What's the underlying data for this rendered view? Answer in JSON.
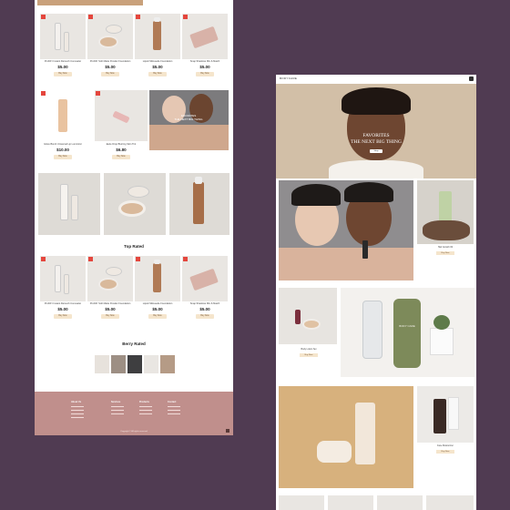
{
  "left_page": {
    "featured_products": [
      {
        "name": "ProFilt'r Instant Retouch Concealer",
        "price": "$5.00",
        "button": "Buy Now"
      },
      {
        "name": "ProFilt'r Soft Matte Powder Foundation",
        "price": "$5.00",
        "button": "Buy Now"
      },
      {
        "name": "Liquid Silksuede Foundation",
        "price": "$5.00",
        "button": "Buy Now"
      },
      {
        "name": "Snap Shadows Mix & Match",
        "price": "$5.00",
        "button": "Buy Now"
      }
    ],
    "second_row_products": [
      {
        "name": "Gloss Bomb Universal Lip Luminizer",
        "price": "$10.00",
        "button": "Buy Now"
      },
      {
        "name": "Eaze Drop Blurring Skin Tint",
        "price": "$6.80",
        "button": "Buy Now"
      }
    ],
    "banner": {
      "title": "FAVORITES",
      "subtitle": "THE NEXT BIG THING"
    },
    "top_rated_title": "Top Rated",
    "top_rated_products": [
      {
        "name": "ProFilt'r Instant Retouch Concealer",
        "price": "$5.00",
        "button": "Buy Now"
      },
      {
        "name": "ProFilt'r Soft Matte Powder Foundation",
        "price": "$5.00",
        "button": "Buy Now"
      },
      {
        "name": "Liquid Silksuede Foundation",
        "price": "$5.00",
        "button": "Buy Now"
      },
      {
        "name": "Snap Shadows Mix & Match",
        "price": "$5.00",
        "button": "Buy Now"
      }
    ],
    "berry_rated_title": "Berry Rated",
    "footer": {
      "columns": [
        "About Us",
        "Services",
        "Products",
        "Contact"
      ],
      "copyright": "Copyright © All rights reserved"
    }
  },
  "right_page": {
    "logo": "BODYCARE",
    "hero": {
      "title_line1": "FAVORITES",
      "title_line2": "THE NEXT BIG THING",
      "button": "Shop"
    },
    "cards": [
      {
        "name": "Hair Growth Oil",
        "button": "Buy Now"
      },
      {
        "name": "Body Lotion Set",
        "button": "Buy Now"
      },
      {
        "name": "Face Moisturizer",
        "button": "Buy Now"
      }
    ],
    "bottle_label": "BODY CARE"
  },
  "colors": {
    "background": "#503b52",
    "accent_gold": "#c9a17b",
    "sale_badge": "#e4463d",
    "footer": "#c08f8c",
    "button_bg": "#f5e5cc"
  }
}
